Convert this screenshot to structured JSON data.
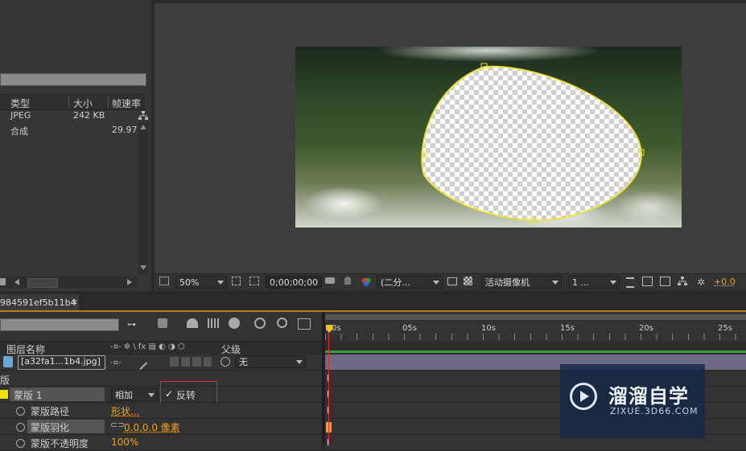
{
  "project": {
    "columns": [
      "类型",
      "大小",
      "帧速率"
    ],
    "items": [
      {
        "type": "JPEG",
        "size": "242 KB",
        "fps": ""
      },
      {
        "type": "合成",
        "size": "",
        "fps": "29.97"
      }
    ]
  },
  "viewer": {
    "zoom": "50%",
    "timecode": "0;00;00;00",
    "resolution": "(二分...",
    "camera": "活动摄像机",
    "views": "1 ...",
    "exposure": "+0.0"
  },
  "timeline": {
    "tab": "984591ef5b11b4",
    "tab_close": "×",
    "ruler_marks": [
      "0s",
      "05s",
      "10s",
      "15s",
      "20s",
      "25s"
    ],
    "header": {
      "layer_name": "图层名称",
      "switch_icons": "-¤- ✲ \\ fx ▤ ◐ ◑ ⬡",
      "parent": "父级"
    },
    "layer": {
      "name": "[a32fa1...1b4.jpg]",
      "parent": "无"
    },
    "section_label": "版",
    "mask": {
      "name": "蒙版 1",
      "mode": "相加",
      "invert_label": "反转",
      "inverted": true
    },
    "props": [
      {
        "name": "蒙版路径",
        "value": "形状..."
      },
      {
        "name": "蒙版羽化",
        "value": "0.0,0.0 像素"
      },
      {
        "name": "蒙版不透明度",
        "value": "100%"
      }
    ]
  },
  "watermark": {
    "title": "溜溜自学",
    "url": "ZIXUE.3D66.COM"
  },
  "colors": {
    "accent": "#f0a020",
    "mask_path": "#f0e030",
    "playhead": "#e03030",
    "highlight_box": "#d03030"
  }
}
